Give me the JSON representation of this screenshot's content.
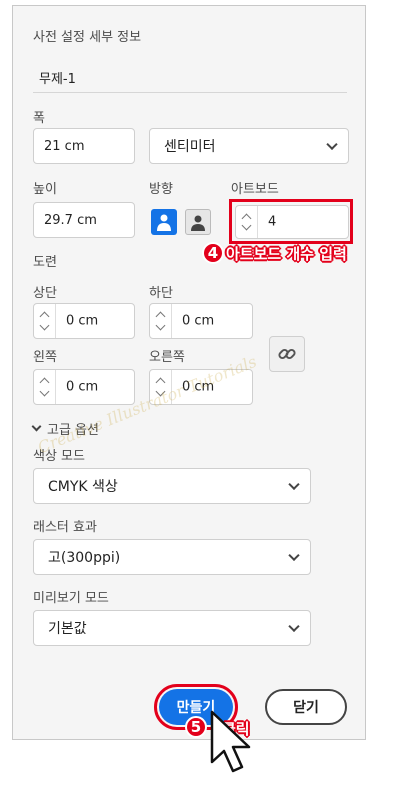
{
  "panel": {
    "title": "사전 설정 세부 정보",
    "document_name": "무제-1"
  },
  "width": {
    "label": "폭",
    "value": "21 cm",
    "unit": "센티미터"
  },
  "height": {
    "label": "높이",
    "value": "29.7 cm"
  },
  "orientation": {
    "label": "방향",
    "selected": "portrait"
  },
  "artboards": {
    "label": "아트보드",
    "value": "4"
  },
  "bleed": {
    "label": "도련",
    "top_label": "상단",
    "top_value": "0 cm",
    "bottom_label": "하단",
    "bottom_value": "0 cm",
    "left_label": "왼쪽",
    "left_value": "0 cm",
    "right_label": "오른쪽",
    "right_value": "0 cm"
  },
  "advanced": {
    "toggle_label": "고급 옵션",
    "color_mode_label": "색상 모드",
    "color_mode_value": "CMYK 색상",
    "raster_label": "래스터 효과",
    "raster_value": "고(300ppi)",
    "preview_label": "미리보기 모드",
    "preview_value": "기본값"
  },
  "buttons": {
    "create": "만들기",
    "close": "닫기"
  },
  "annotations": {
    "step4_number": "4",
    "step4_text": "아트보드 개수 입력",
    "step5_number": "5",
    "step5_text": "클릭",
    "color": "#e3001b"
  },
  "watermark": {
    "text": "Creative Illustrator Tutorials"
  },
  "colors": {
    "accent": "#1473e6",
    "panel_bg": "#f5f5f5"
  }
}
